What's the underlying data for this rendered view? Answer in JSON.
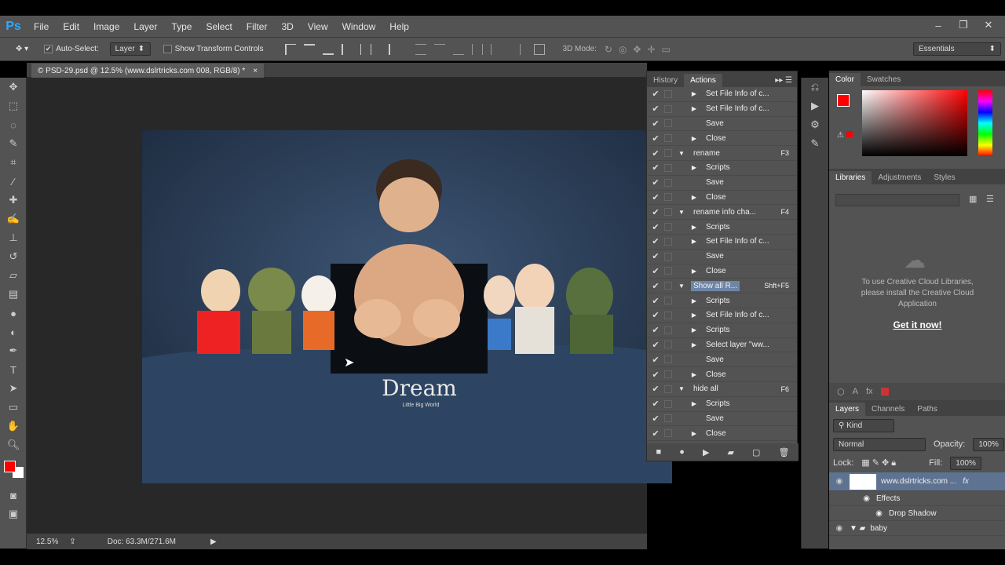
{
  "app": {
    "logo": "Ps",
    "menu": [
      "File",
      "Edit",
      "Image",
      "Layer",
      "Type",
      "Select",
      "Filter",
      "3D",
      "View",
      "Window",
      "Help"
    ],
    "window_controls": [
      "–",
      "❐",
      "✕"
    ]
  },
  "options": {
    "auto_select_label": "Auto-Select:",
    "auto_select_value": "Layer",
    "show_transform": "Show Transform Controls",
    "mode_3d": "3D Mode:",
    "workspace": "Essentials"
  },
  "document": {
    "tab_title": "© PSD-29.psd @ 12.5% (www.dslrtricks.com 008, RGB/8) *",
    "tab_close": "×",
    "zoom": "12.5%",
    "doc_size": "Doc: 63.3M/271.6M",
    "watermark_title": "Dream",
    "watermark_sub": "Little Big World"
  },
  "actions_panel": {
    "tabs": [
      "History",
      "Actions"
    ],
    "rows": [
      {
        "label": "Set File Info of c...",
        "indent": 2,
        "arrow": "▶",
        "key": ""
      },
      {
        "label": "Set File Info of c...",
        "indent": 2,
        "arrow": "▶",
        "key": ""
      },
      {
        "label": "Save",
        "indent": 2,
        "arrow": "",
        "key": ""
      },
      {
        "label": "Close",
        "indent": 2,
        "arrow": "▶",
        "key": ""
      },
      {
        "label": "rename",
        "indent": 1,
        "arrow": "▼",
        "key": "F3"
      },
      {
        "label": "Scripts",
        "indent": 2,
        "arrow": "▶",
        "key": ""
      },
      {
        "label": "Save",
        "indent": 2,
        "arrow": "",
        "key": ""
      },
      {
        "label": "Close",
        "indent": 2,
        "arrow": "▶",
        "key": ""
      },
      {
        "label": "rename info cha...",
        "indent": 1,
        "arrow": "▼",
        "key": "F4"
      },
      {
        "label": "Scripts",
        "indent": 2,
        "arrow": "▶",
        "key": ""
      },
      {
        "label": "Set File Info of c...",
        "indent": 2,
        "arrow": "▶",
        "key": ""
      },
      {
        "label": "Save",
        "indent": 2,
        "arrow": "",
        "key": ""
      },
      {
        "label": "Close",
        "indent": 2,
        "arrow": "▶",
        "key": ""
      },
      {
        "label": "Show all R...",
        "indent": 1,
        "arrow": "▼",
        "key": "Shft+F5",
        "selected": true
      },
      {
        "label": "Scripts",
        "indent": 2,
        "arrow": "▶",
        "key": ""
      },
      {
        "label": "Set File Info of c...",
        "indent": 2,
        "arrow": "▶",
        "key": ""
      },
      {
        "label": "Scripts",
        "indent": 2,
        "arrow": "▶",
        "key": ""
      },
      {
        "label": "Select layer \"ww...",
        "indent": 2,
        "arrow": "▶",
        "key": ""
      },
      {
        "label": "Save",
        "indent": 2,
        "arrow": "",
        "key": ""
      },
      {
        "label": "Close",
        "indent": 2,
        "arrow": "▶",
        "key": ""
      },
      {
        "label": "hide all",
        "indent": 1,
        "arrow": "▼",
        "key": "F6"
      },
      {
        "label": "Scripts",
        "indent": 2,
        "arrow": "▶",
        "key": ""
      },
      {
        "label": "Save",
        "indent": 2,
        "arrow": "",
        "key": ""
      },
      {
        "label": "Close",
        "indent": 2,
        "arrow": "▶",
        "key": ""
      }
    ]
  },
  "color_panel": {
    "tabs": [
      "Color",
      "Swatches"
    ],
    "fg": "#ff0000"
  },
  "libraries_panel": {
    "tabs": [
      "Libraries",
      "Adjustments",
      "Styles"
    ],
    "message": "To use Creative Cloud Libraries, please install the Creative Cloud Application",
    "link": "Get it now!"
  },
  "layers_panel": {
    "tabs": [
      "Layers",
      "Channels",
      "Paths"
    ],
    "kind": "Kind",
    "blend": "Normal",
    "opacity_label": "Opacity:",
    "opacity": "100%",
    "lock_label": "Lock:",
    "fill_label": "Fill:",
    "fill": "100%",
    "layers": [
      {
        "name": "www.dslrtricks.com ...",
        "fx": "fx"
      },
      {
        "name": "Effects"
      },
      {
        "name": "Drop Shadow"
      },
      {
        "name": "baby"
      }
    ]
  }
}
